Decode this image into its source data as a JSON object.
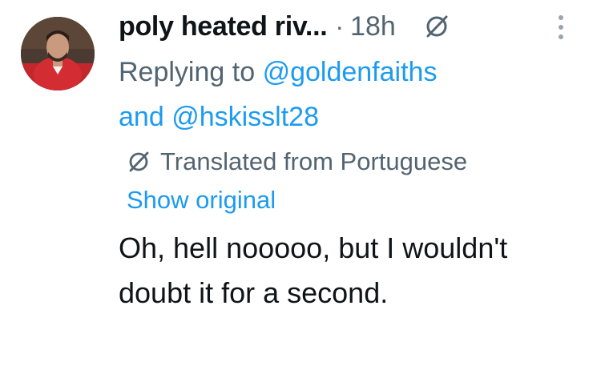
{
  "author": {
    "display_name": "poly heated riv...",
    "separator": "·",
    "time": "18h"
  },
  "reply": {
    "prefix": "Replying to",
    "mention_1": "@goldenfaiths",
    "joiner": "and",
    "mention_2": "@hskisslt28"
  },
  "translation": {
    "label": "Translated from Portuguese",
    "show_original": "Show original"
  },
  "tweet": {
    "text": "Oh, hell nooooo, but I wouldn't doubt it for a second."
  },
  "icons": {
    "header_translate": "translate-icon",
    "more": "more-options-icon",
    "translation_badge": "translate-icon"
  },
  "colors": {
    "link": "#1d9bf0",
    "secondary": "#536471",
    "primary_text": "#0f1419"
  }
}
